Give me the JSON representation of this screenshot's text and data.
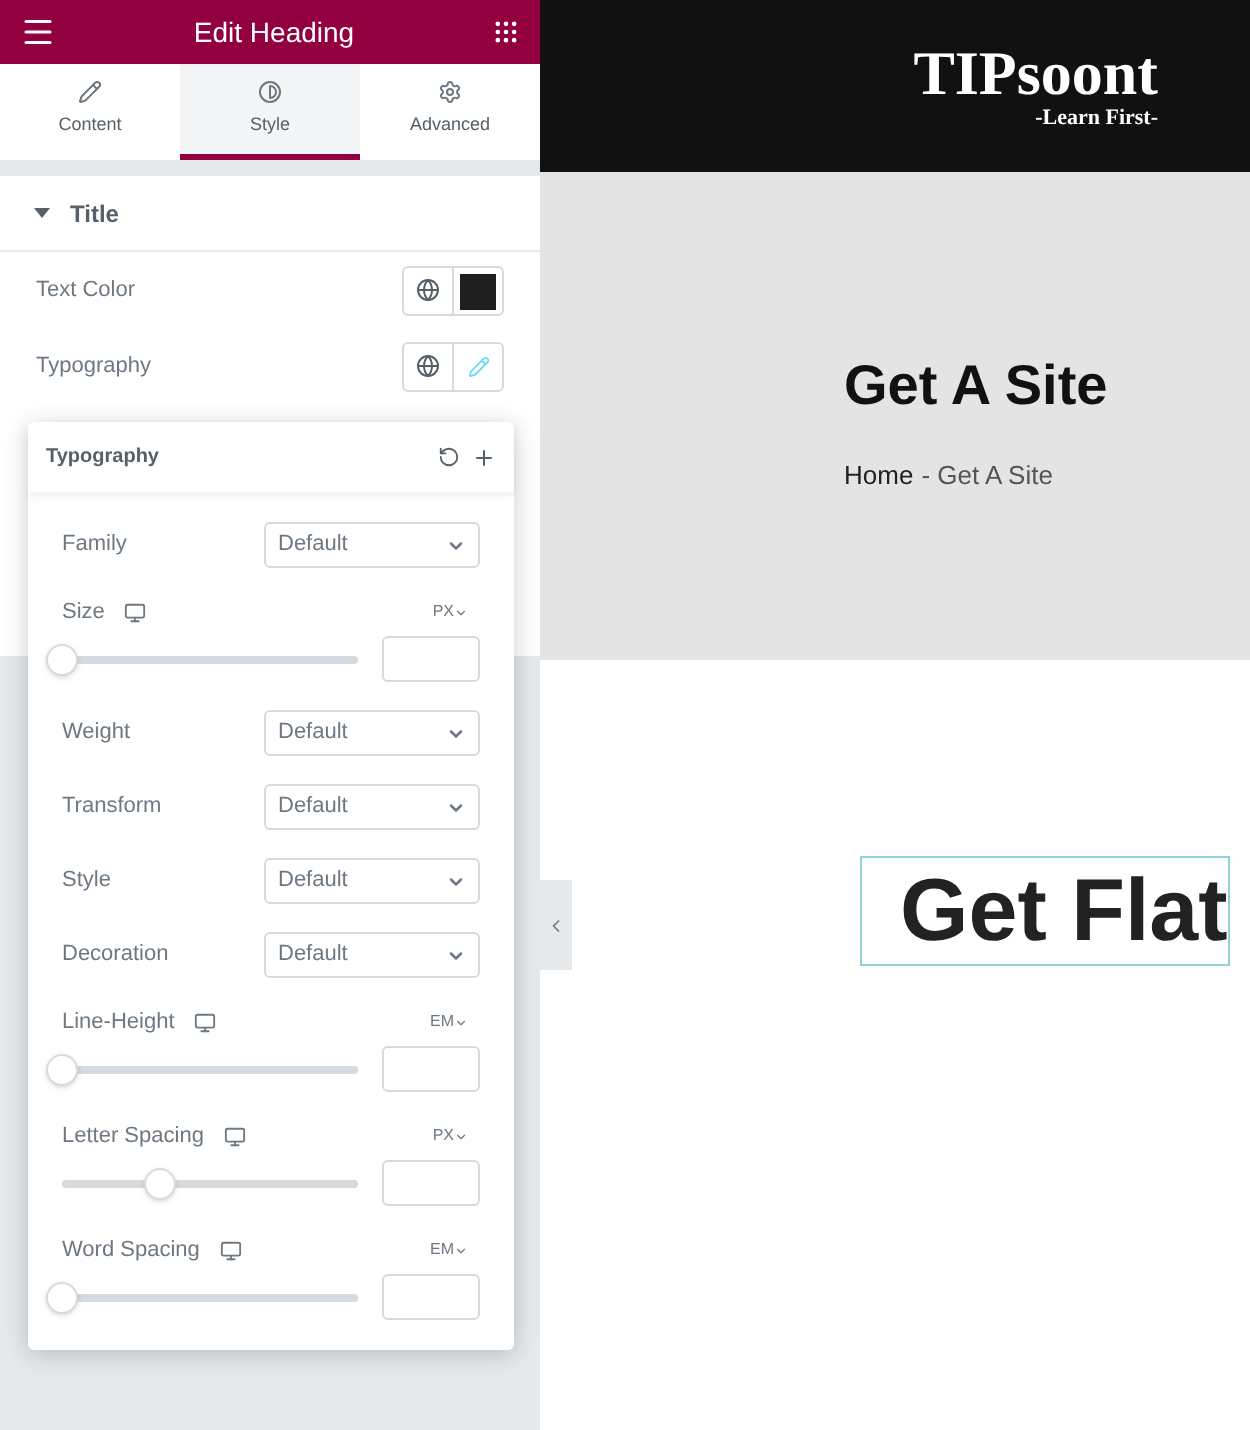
{
  "panel": {
    "title": "Edit Heading",
    "tabs": [
      {
        "label": "Content",
        "selected": false
      },
      {
        "label": "Style",
        "selected": true
      },
      {
        "label": "Advanced",
        "selected": false
      }
    ],
    "section": {
      "title": "Title",
      "expanded": true
    },
    "rows": [
      {
        "label": "Text Color",
        "kind": "color",
        "color": "#1f1f1f"
      },
      {
        "label": "Typography",
        "kind": "edit"
      }
    ],
    "popover": {
      "title": "Typography",
      "controls": [
        {
          "kind": "select",
          "label": "Family",
          "value": "Default"
        },
        {
          "kind": "slider",
          "label": "Size",
          "unit": "PX",
          "level": 0
        },
        {
          "kind": "select",
          "label": "Weight",
          "value": "Default"
        },
        {
          "kind": "select",
          "label": "Transform",
          "value": "Default"
        },
        {
          "kind": "select",
          "label": "Style",
          "value": "Default"
        },
        {
          "kind": "select",
          "label": "Decoration",
          "value": "Default"
        },
        {
          "kind": "slider",
          "label": "Line-Height",
          "unit": "EM",
          "level": 0
        },
        {
          "kind": "slider",
          "label": "Letter Spacing",
          "unit": "PX",
          "level": 0.33
        },
        {
          "kind": "slider",
          "label": "Word Spacing",
          "unit": "EM",
          "level": 0
        }
      ]
    }
  },
  "site": {
    "logo": "TIPsoont",
    "tagline": "-Learn First-",
    "hero_title": "Get A Site",
    "breadcrumb_home": "Home",
    "breadcrumb_rest": "- Get A Site",
    "heading": "Get Flat"
  }
}
